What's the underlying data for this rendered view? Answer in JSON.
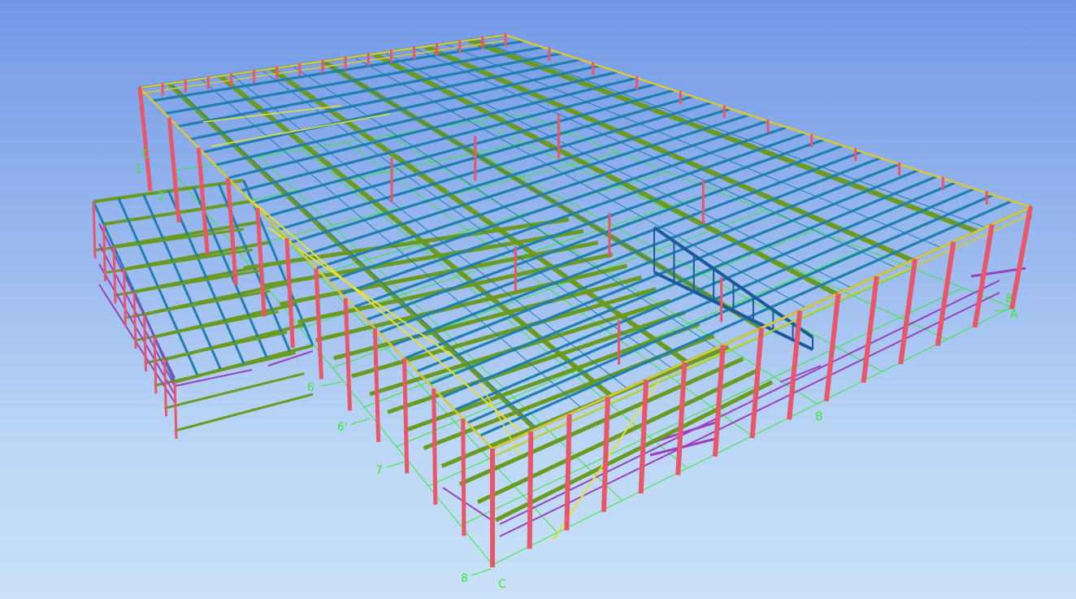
{
  "view": {
    "background_top": "#7398e6",
    "background_bottom": "#c9e2f8"
  },
  "colors": {
    "columns": "#e8566a",
    "beams": "#6a9a22",
    "purlins": "#1f7fb0",
    "rafters": "#1a5a9a",
    "bracing": "#e8e030",
    "edge_members": "#d8c838",
    "girts": "#9a40c0",
    "gridlines": "#38e838",
    "labels": "#38e838"
  },
  "grid_labels": {
    "g1": "1",
    "g2": "2",
    "g6": "6",
    "g6p": "6'",
    "g7": "7",
    "g8_front": "8",
    "gC_front": "C",
    "gB": "B",
    "gA": "A",
    "g8_right": "8",
    "gC_left": "C"
  }
}
